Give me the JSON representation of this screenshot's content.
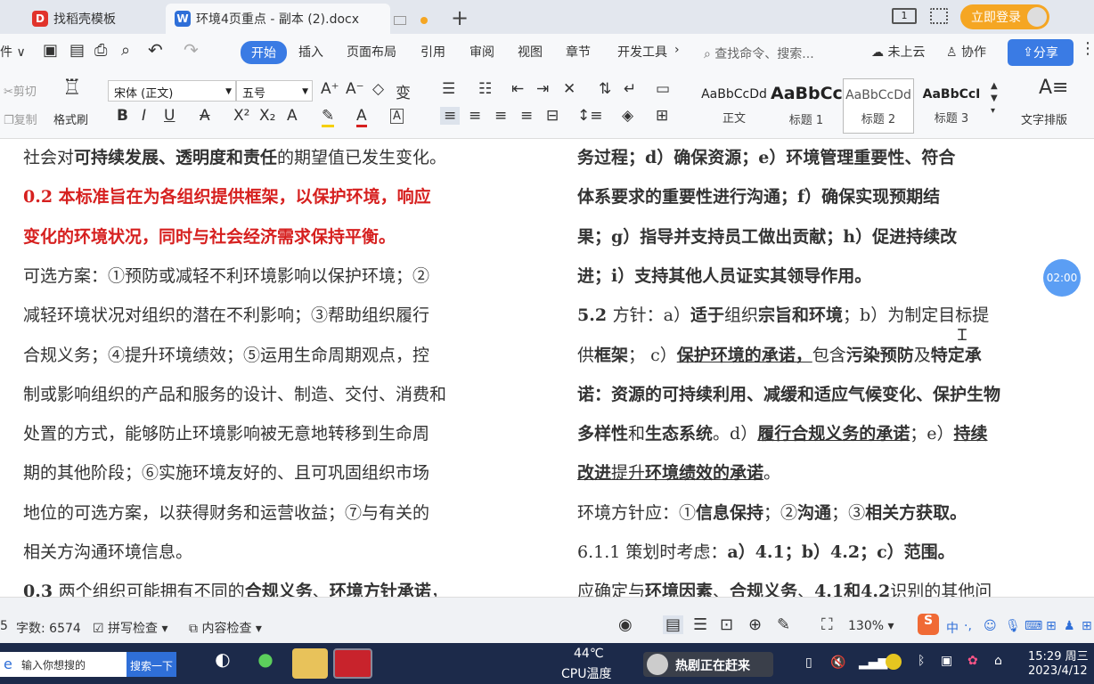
{
  "tabs": [
    {
      "label": "找稻壳模板"
    },
    {
      "label": "环境4页重点 - 副本 (2).docx"
    }
  ],
  "titlebar": {
    "new_tab": "+",
    "login": "立即登录",
    "page_icon": "1"
  },
  "menu": {
    "items": [
      "开始",
      "插入",
      "页面布局",
      "引用",
      "审阅",
      "视图",
      "章节",
      "开发工具"
    ],
    "search_placeholder": "查找命令、搜索...",
    "cloud": "未上云",
    "collab": "协作",
    "share": "分享"
  },
  "ribbon": {
    "cut": "剪切",
    "copy": "复制",
    "format_painter": "格式刷",
    "font_name": "宋体 (正文)",
    "font_size": "五号",
    "styles": [
      {
        "preview": "AaBbCcDd",
        "name": "正文"
      },
      {
        "preview": "AaBbCc",
        "name": "标题 1"
      },
      {
        "preview": "AaBbCcDd",
        "name": "标题 2"
      },
      {
        "preview": "AaBbCcI",
        "name": "标题 3"
      }
    ],
    "text_layout": "文字排版"
  },
  "doc": {
    "left": [
      [
        {
          "t": "社会对"
        },
        {
          "t": "可持续发展、透明度和责任",
          "s": "b"
        },
        {
          "t": "的期望值已发生变化。"
        }
      ],
      [
        {
          "t": "0.2  ",
          "s": "red"
        },
        {
          "t": "本标准旨在为各组织提供框架，以保护环境，响应",
          "s": "red"
        }
      ],
      [
        {
          "t": "变化的环境状况，同时与社会经济需求保持平衡。",
          "s": "red"
        }
      ],
      [
        {
          "t": "可选方案：①预防或减轻不利环境影响以保护环境；②"
        }
      ],
      [
        {
          "t": "减轻环境状况对组织的潜在不利影响；③帮助组织履行"
        }
      ],
      [
        {
          "t": "合规义务；④提升环境绩效；⑤运用生命周期观点，控"
        }
      ],
      [
        {
          "t": "制或影响组织的产品和服务的设计、制造、交付、消费和"
        }
      ],
      [
        {
          "t": "处置的方式，能够防止环境影响被无意地转移到生命周"
        }
      ],
      [
        {
          "t": "期的其他阶段；⑥实施环境友好的、且可巩固组织市场"
        }
      ],
      [
        {
          "t": "地位的可选方案，以获得财务和运营收益；⑦与有关的"
        }
      ],
      [
        {
          "t": "相关方沟通环境信息。"
        }
      ],
      [
        {
          "t": "0.3 ",
          "s": "b"
        },
        {
          "t": "两个组织可能拥有不同的"
        },
        {
          "t": "合规义务",
          "s": "b"
        },
        {
          "t": "、"
        },
        {
          "t": "环境方针承诺",
          "s": "b"
        },
        {
          "t": "，"
        }
      ]
    ],
    "right": [
      [
        {
          "t": "务过程；d）确保资源；e）环境管理重要性、符合",
          "s": "b"
        }
      ],
      [
        {
          "t": "体系要求的重要性进行沟通；f）确保实现预期结",
          "s": "b"
        }
      ],
      [
        {
          "t": "果；g）指导并支持员工做出贡献；h）促进持续改",
          "s": "b"
        }
      ],
      [
        {
          "t": "进；i）支持其他人员证实其领导作用。",
          "s": "b"
        }
      ],
      [
        {
          "t": "5.2 ",
          "s": "b"
        },
        {
          "t": "方针：a）"
        },
        {
          "t": "适于",
          "s": "b"
        },
        {
          "t": "组织"
        },
        {
          "t": "宗旨和环境",
          "s": "b"
        },
        {
          "t": "；b）为制定目标提"
        }
      ],
      [
        {
          "t": "供"
        },
        {
          "t": "框架",
          "s": "b"
        },
        {
          "t": "；  c）"
        },
        {
          "t": "保护环境的承诺，",
          "s": "bu"
        },
        {
          "t": "包含"
        },
        {
          "t": "污染预防",
          "s": "b"
        },
        {
          "t": "及"
        },
        {
          "t": "特定承",
          "s": "b"
        }
      ],
      [
        {
          "t": "诺",
          "s": "b"
        },
        {
          "t": "：资源的可持续利用、减缓和适应气候变化、保护生物",
          "s": "b"
        }
      ],
      [
        {
          "t": "多样性",
          "s": "b"
        },
        {
          "t": "和"
        },
        {
          "t": "生态系统",
          "s": "b"
        },
        {
          "t": "。d）"
        },
        {
          "t": "履行合规义务的承诺",
          "s": "bu"
        },
        {
          "t": "；e）"
        },
        {
          "t": "持续",
          "s": "bu"
        }
      ],
      [
        {
          "t": "改进",
          "s": "bu"
        },
        {
          "t": "提升",
          "s": "u"
        },
        {
          "t": "环境绩效的承诺",
          "s": "bu"
        },
        {
          "t": "。"
        }
      ],
      [
        {
          "t": "环境方针应：①"
        },
        {
          "t": "信息保持",
          "s": "b"
        },
        {
          "t": "；②"
        },
        {
          "t": "沟通",
          "s": "b"
        },
        {
          "t": "；③"
        },
        {
          "t": "相关方获取。",
          "s": "b"
        }
      ],
      [
        {
          "t": "6.1.1 策划时考虑："
        },
        {
          "t": "a）4.1；b）4.2；c）范围。",
          "s": "b"
        }
      ],
      [
        {
          "t": "应确定与"
        },
        {
          "t": "环境因素",
          "s": "b"
        },
        {
          "t": "、"
        },
        {
          "t": "合规义务",
          "s": "b"
        },
        {
          "t": "、"
        },
        {
          "t": "4.1和4.2",
          "s": "b"
        },
        {
          "t": "识别的其他问"
        }
      ]
    ],
    "timer": "02:00"
  },
  "status": {
    "page": "5",
    "word_count": "字数: 6574",
    "spell_check": "拼写检查",
    "content_check": "内容检查",
    "zoom": "130%",
    "ime": "中"
  },
  "taskbar": {
    "search_placeholder": "输入你想搜的",
    "search_button": "搜索一下",
    "temperature": "44℃",
    "cpu_label": "CPU温度",
    "promo": "热剧正在赶来",
    "time": "15:29 周三",
    "date": "2023/4/12"
  },
  "colors": {
    "accent": "#3a7be4",
    "red_text": "#d6201f",
    "login": "#f5a623",
    "taskbar": "#1c2a4a"
  }
}
